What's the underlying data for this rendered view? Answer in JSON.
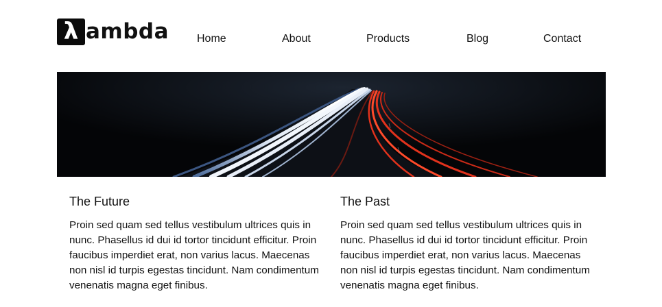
{
  "logo": {
    "mark": "λ",
    "text": "ambda"
  },
  "nav": {
    "items": [
      {
        "label": "Home"
      },
      {
        "label": "About"
      },
      {
        "label": "Products"
      },
      {
        "label": "Blog"
      },
      {
        "label": "Contact"
      }
    ]
  },
  "hero": {
    "image": "night-highway-light-trails"
  },
  "columns": [
    {
      "title": "The Future",
      "body": "Proin sed quam sed tellus vestibulum ultrices quis in nunc. Phasellus id dui id tortor tincidunt efficitur. Proin faucibus imperdiet erat, non varius lacus. Maecenas non nisl id turpis egestas tincidunt. Nam condimentum venenatis magna eget finibus."
    },
    {
      "title": "The Past",
      "body": "Proin sed quam sed tellus vestibulum ultrices quis in nunc. Phasellus id dui id tortor tincidunt efficitur. Proin faucibus imperdiet erat, non varius lacus. Maecenas non nisl id turpis egestas tincidunt. Nam condimentum venenatis magna eget finibus."
    }
  ],
  "colors": {
    "text": "#111111",
    "background": "#ffffff",
    "hero_dark": "#05070a",
    "trail_white": "#e8eef8",
    "trail_red": "#e2321c"
  }
}
